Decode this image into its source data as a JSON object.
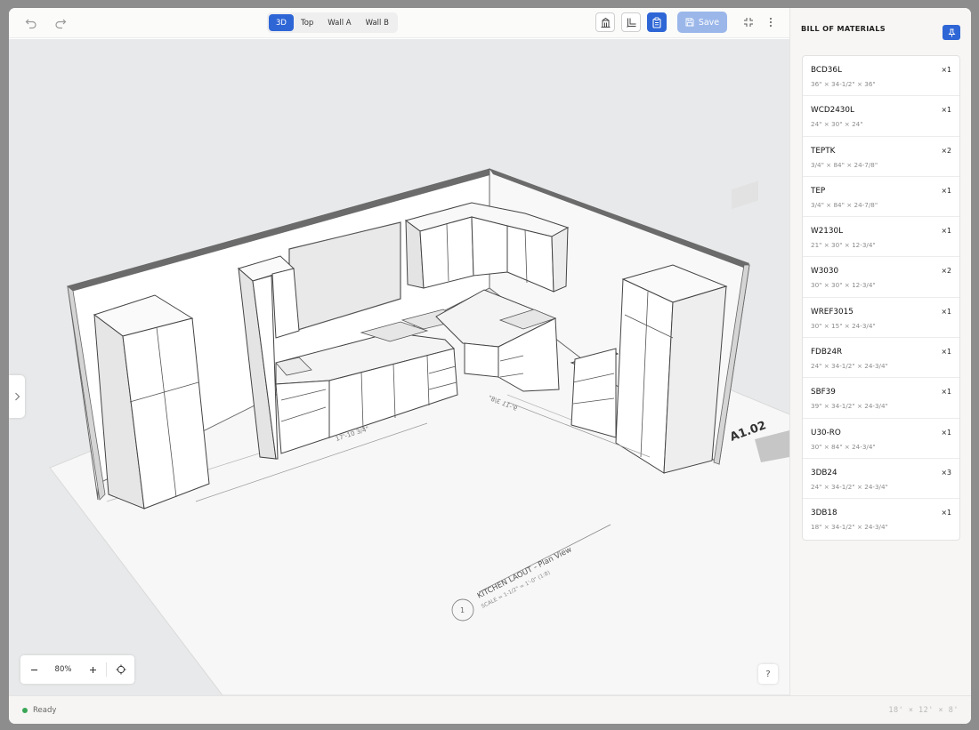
{
  "toolbar": {
    "view_tabs": [
      {
        "label": "3D",
        "active": true
      },
      {
        "label": "Top",
        "active": false
      },
      {
        "label": "Wall A",
        "active": false
      },
      {
        "label": "Wall B",
        "active": false
      }
    ],
    "save_label": "Save"
  },
  "canvas": {
    "dimension_left": "17'-10 3/4\"",
    "dimension_right": "9'-11 3/8\"",
    "sheet_number": "A1.02",
    "drawing_number": "1",
    "drawing_title": "KITCHEN LAOUT - Plan View",
    "drawing_scale": "SCALE = 1-1/2\" = 1'-0\" (1:8)"
  },
  "zoom": {
    "level": "80%"
  },
  "help_label": "?",
  "bom": {
    "title": "BILL OF MATERIALS",
    "items": [
      {
        "code": "BCD36L",
        "dims": "36\" × 34-1/2\" × 36\"",
        "qty": "×1"
      },
      {
        "code": "WCD2430L",
        "dims": "24\" × 30\" × 24\"",
        "qty": "×1"
      },
      {
        "code": "TEPTK",
        "dims": "3/4\" × 84\" × 24-7/8\"",
        "qty": "×2"
      },
      {
        "code": "TEP",
        "dims": "3/4\" × 84\" × 24-7/8\"",
        "qty": "×1"
      },
      {
        "code": "W2130L",
        "dims": "21\" × 30\" × 12-3/4\"",
        "qty": "×1"
      },
      {
        "code": "W3030",
        "dims": "30\" × 30\" × 12-3/4\"",
        "qty": "×2"
      },
      {
        "code": "WREF3015",
        "dims": "30\" × 15\" × 24-3/4\"",
        "qty": "×1"
      },
      {
        "code": "FDB24R",
        "dims": "24\" × 34-1/2\" × 24-3/4\"",
        "qty": "×1"
      },
      {
        "code": "SBF39",
        "dims": "39\" × 34-1/2\" × 24-3/4\"",
        "qty": "×1"
      },
      {
        "code": "U30-RO",
        "dims": "30\" × 84\" × 24-3/4\"",
        "qty": "×1"
      },
      {
        "code": "3DB24",
        "dims": "24\" × 34-1/2\" × 24-3/4\"",
        "qty": "×3"
      },
      {
        "code": "3DB18",
        "dims": "18\" × 34-1/2\" × 24-3/4\"",
        "qty": "×1"
      }
    ]
  },
  "status": {
    "text": "Ready",
    "room_dims": "18' × 12' × 8'"
  },
  "colors": {
    "accent": "#2e66d6",
    "status_ok": "#3aa655",
    "save_disabled": "#9bb7ea"
  },
  "icons": [
    "undo-icon",
    "redo-icon",
    "elevation-icon",
    "plan-icon",
    "clipboard-icon",
    "save-icon",
    "fit-view-icon",
    "more-icon",
    "pin-icon",
    "chevron-right-icon",
    "zoom-out-icon",
    "zoom-in-icon",
    "crosshair-icon",
    "help-icon"
  ]
}
